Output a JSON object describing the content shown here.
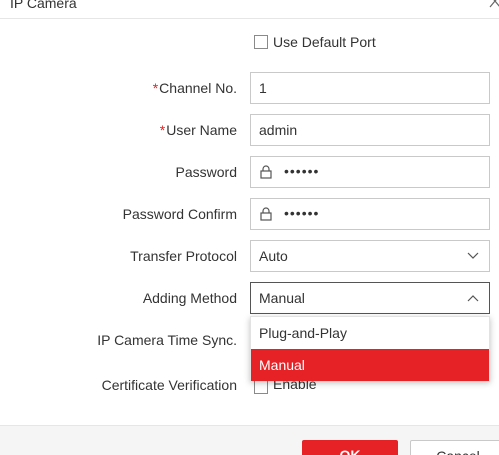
{
  "dialog": {
    "title": "IP Camera"
  },
  "form": {
    "use_default_port_label": "Use Default Port",
    "channel_no": {
      "label": "Channel No.",
      "value": "1"
    },
    "user_name": {
      "label": "User Name",
      "value": "admin"
    },
    "password": {
      "label": "Password",
      "value": "••••••"
    },
    "password_confirm": {
      "label": "Password Confirm",
      "value": "••••••"
    },
    "transfer_protocol": {
      "label": "Transfer Protocol",
      "value": "Auto"
    },
    "adding_method": {
      "label": "Adding Method",
      "value": "Manual",
      "options": [
        "Plug-and-Play",
        "Manual"
      ]
    },
    "time_sync": {
      "label": "IP Camera Time Sync."
    },
    "certificate_verification": {
      "label": "Certificate Verification",
      "checkbox_label": "Enable"
    }
  },
  "footer": {
    "ok_label": "OK",
    "cancel_label": "Cancel"
  },
  "colors": {
    "accent": "#e72227",
    "required": "#e72323"
  }
}
